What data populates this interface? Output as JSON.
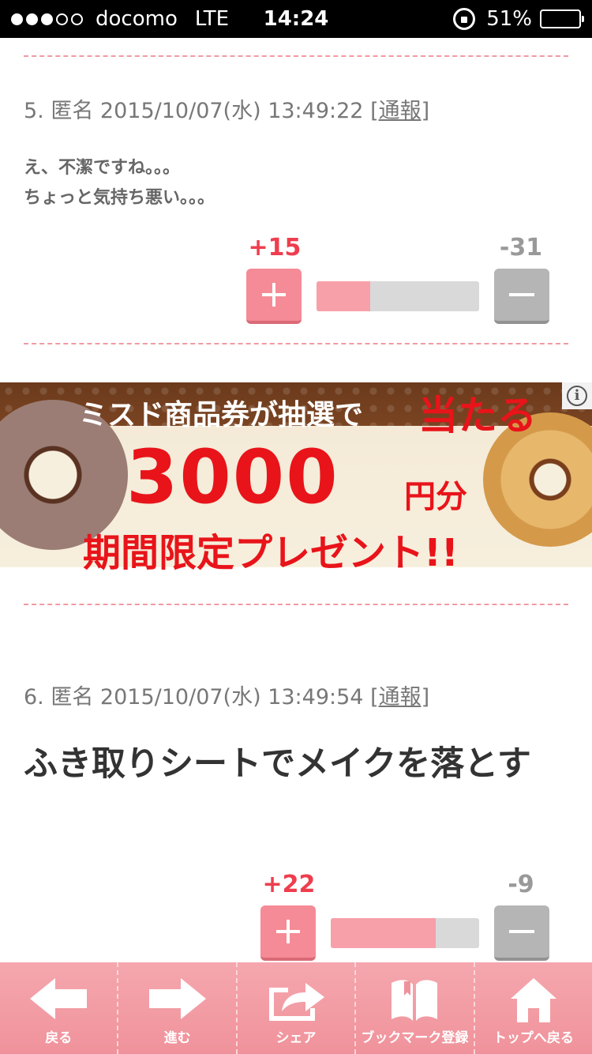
{
  "status_bar": {
    "signal_dots_filled": 3,
    "signal_dots_total": 5,
    "carrier": "docomo",
    "network": "LTE",
    "time": "14:24",
    "battery": "51%"
  },
  "comments": [
    {
      "meta": "5. 匿名 2015/10/07(水) 13:49:22",
      "report": "[通報]",
      "body": "え、不潔ですね。。。\nちょっと気持ち悪い。。。",
      "plus": "+15",
      "minus": "-31",
      "plus_share": 0.33
    },
    {
      "meta": "6. 匿名 2015/10/07(水) 13:49:54",
      "report": "[通報]",
      "body": "ふき取りシートでメイクを落とす",
      "plus": "+22",
      "minus": "-9",
      "plus_share": 0.71
    }
  ],
  "ad": {
    "line1": "ミスド商品券が抽選で",
    "win": "当たる",
    "amount": "3000",
    "unit": "円分",
    "line3": "期間限定プレゼント!!",
    "info": "i"
  },
  "toolbar": {
    "items": [
      {
        "label": "戻る",
        "icon": "back-arrow-icon"
      },
      {
        "label": "進む",
        "icon": "forward-arrow-icon"
      },
      {
        "label": "シェア",
        "icon": "share-icon"
      },
      {
        "label": "ブックマーク登録",
        "icon": "bookmark-icon"
      },
      {
        "label": "トップへ戻る",
        "icon": "home-icon"
      }
    ]
  },
  "colors": {
    "accent_pink": "#f58b96",
    "plus_red": "#ee3e4e",
    "minus_gray": "#999999",
    "toolbar_pink": "#f0929b"
  }
}
